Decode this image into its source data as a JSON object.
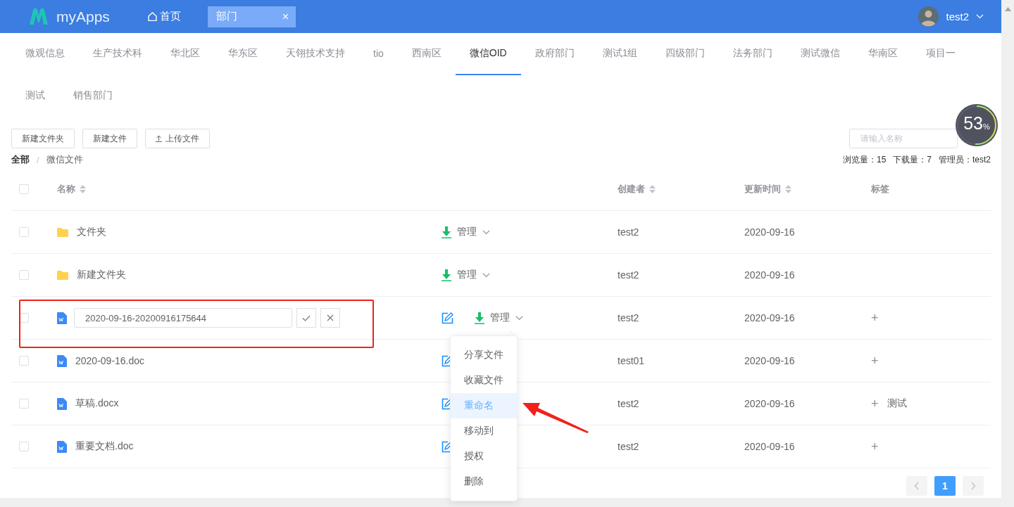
{
  "header": {
    "logo_text": "myApps",
    "home_tab": "首页",
    "open_tabs": [
      {
        "label": "部门",
        "close": "×",
        "selected": true
      }
    ],
    "user": {
      "name": "test2"
    }
  },
  "departments": [
    {
      "label": "微观信息",
      "selected": false
    },
    {
      "label": "生产技术科",
      "selected": false
    },
    {
      "label": "华北区",
      "selected": false
    },
    {
      "label": "华东区",
      "selected": false
    },
    {
      "label": "天翎技术支持",
      "selected": false
    },
    {
      "label": "tio",
      "selected": false
    },
    {
      "label": "西南区",
      "selected": false
    },
    {
      "label": "微信OID",
      "selected": true
    },
    {
      "label": "政府部门",
      "selected": false
    },
    {
      "label": "测试1组",
      "selected": false
    },
    {
      "label": "四级部门",
      "selected": false
    },
    {
      "label": "法务部门",
      "selected": false
    },
    {
      "label": "测试微信",
      "selected": false
    },
    {
      "label": "华南区",
      "selected": false
    },
    {
      "label": "项目一",
      "selected": false
    },
    {
      "label": "测试",
      "selected": false
    },
    {
      "label": "销售部门",
      "selected": false
    }
  ],
  "toolbar": {
    "buttons": [
      {
        "label": "新建文件夹",
        "kind": "plain"
      },
      {
        "label": "新建文件",
        "kind": "plain"
      },
      {
        "label": "上传文件",
        "kind": "upload"
      }
    ],
    "search": {
      "placeholder": "请输入名称"
    }
  },
  "breadcrumb": [
    {
      "label": "全部",
      "current": false
    },
    {
      "label": "微信文件",
      "current": true
    }
  ],
  "breadcrumb_separator": "/",
  "stats": "浏览量：15   下载量：7   管理员：test2",
  "gauge": {
    "value": "53",
    "unit": "%",
    "level": 0.53
  },
  "table": {
    "select_all_checked": false,
    "columns": [
      {
        "label": "名称",
        "sortable": true
      },
      {
        "label": "创建者",
        "sortable": true
      },
      {
        "label": "更新时间",
        "sortable": true
      },
      {
        "label": "标签",
        "sortable": false
      }
    ],
    "rows": [
      {
        "kind": "folder",
        "name": "文件夹",
        "manage": "管理",
        "creator": "test2",
        "updated": "2020-09-16",
        "checked": false
      },
      {
        "kind": "folder",
        "name": "新建文件夹",
        "manage": "管理",
        "creator": "test2",
        "updated": "2020-09-16",
        "checked": false
      },
      {
        "kind": "editing",
        "name": "2020-09-16-20200916175644",
        "manage": "管理",
        "creator": "test2",
        "updated": "2020-09-16",
        "checked": false,
        "tag_add": "+"
      },
      {
        "kind": "file",
        "name": "2020-09-16.doc",
        "creator": "test01",
        "updated": "2020-09-16",
        "checked": false,
        "tag_add": "+"
      },
      {
        "kind": "file",
        "name": "草稿.docx",
        "creator": "test2",
        "updated": "2020-09-16",
        "checked": false,
        "tag_add": "+",
        "tag": "测试"
      },
      {
        "kind": "file",
        "name": "重要文档.doc",
        "creator": "test2",
        "updated": "2020-09-16",
        "checked": false,
        "tag_add": "+"
      }
    ]
  },
  "menu": {
    "items": [
      {
        "label": "分享文件",
        "selected": false
      },
      {
        "label": "收藏文件",
        "selected": false
      },
      {
        "label": "重命名",
        "selected": true
      },
      {
        "label": "移动到",
        "selected": false
      },
      {
        "label": "授权",
        "selected": false
      },
      {
        "label": "删除",
        "selected": false
      }
    ]
  },
  "pagination": {
    "pages": [
      {
        "label": "1",
        "selected": true
      }
    ]
  }
}
